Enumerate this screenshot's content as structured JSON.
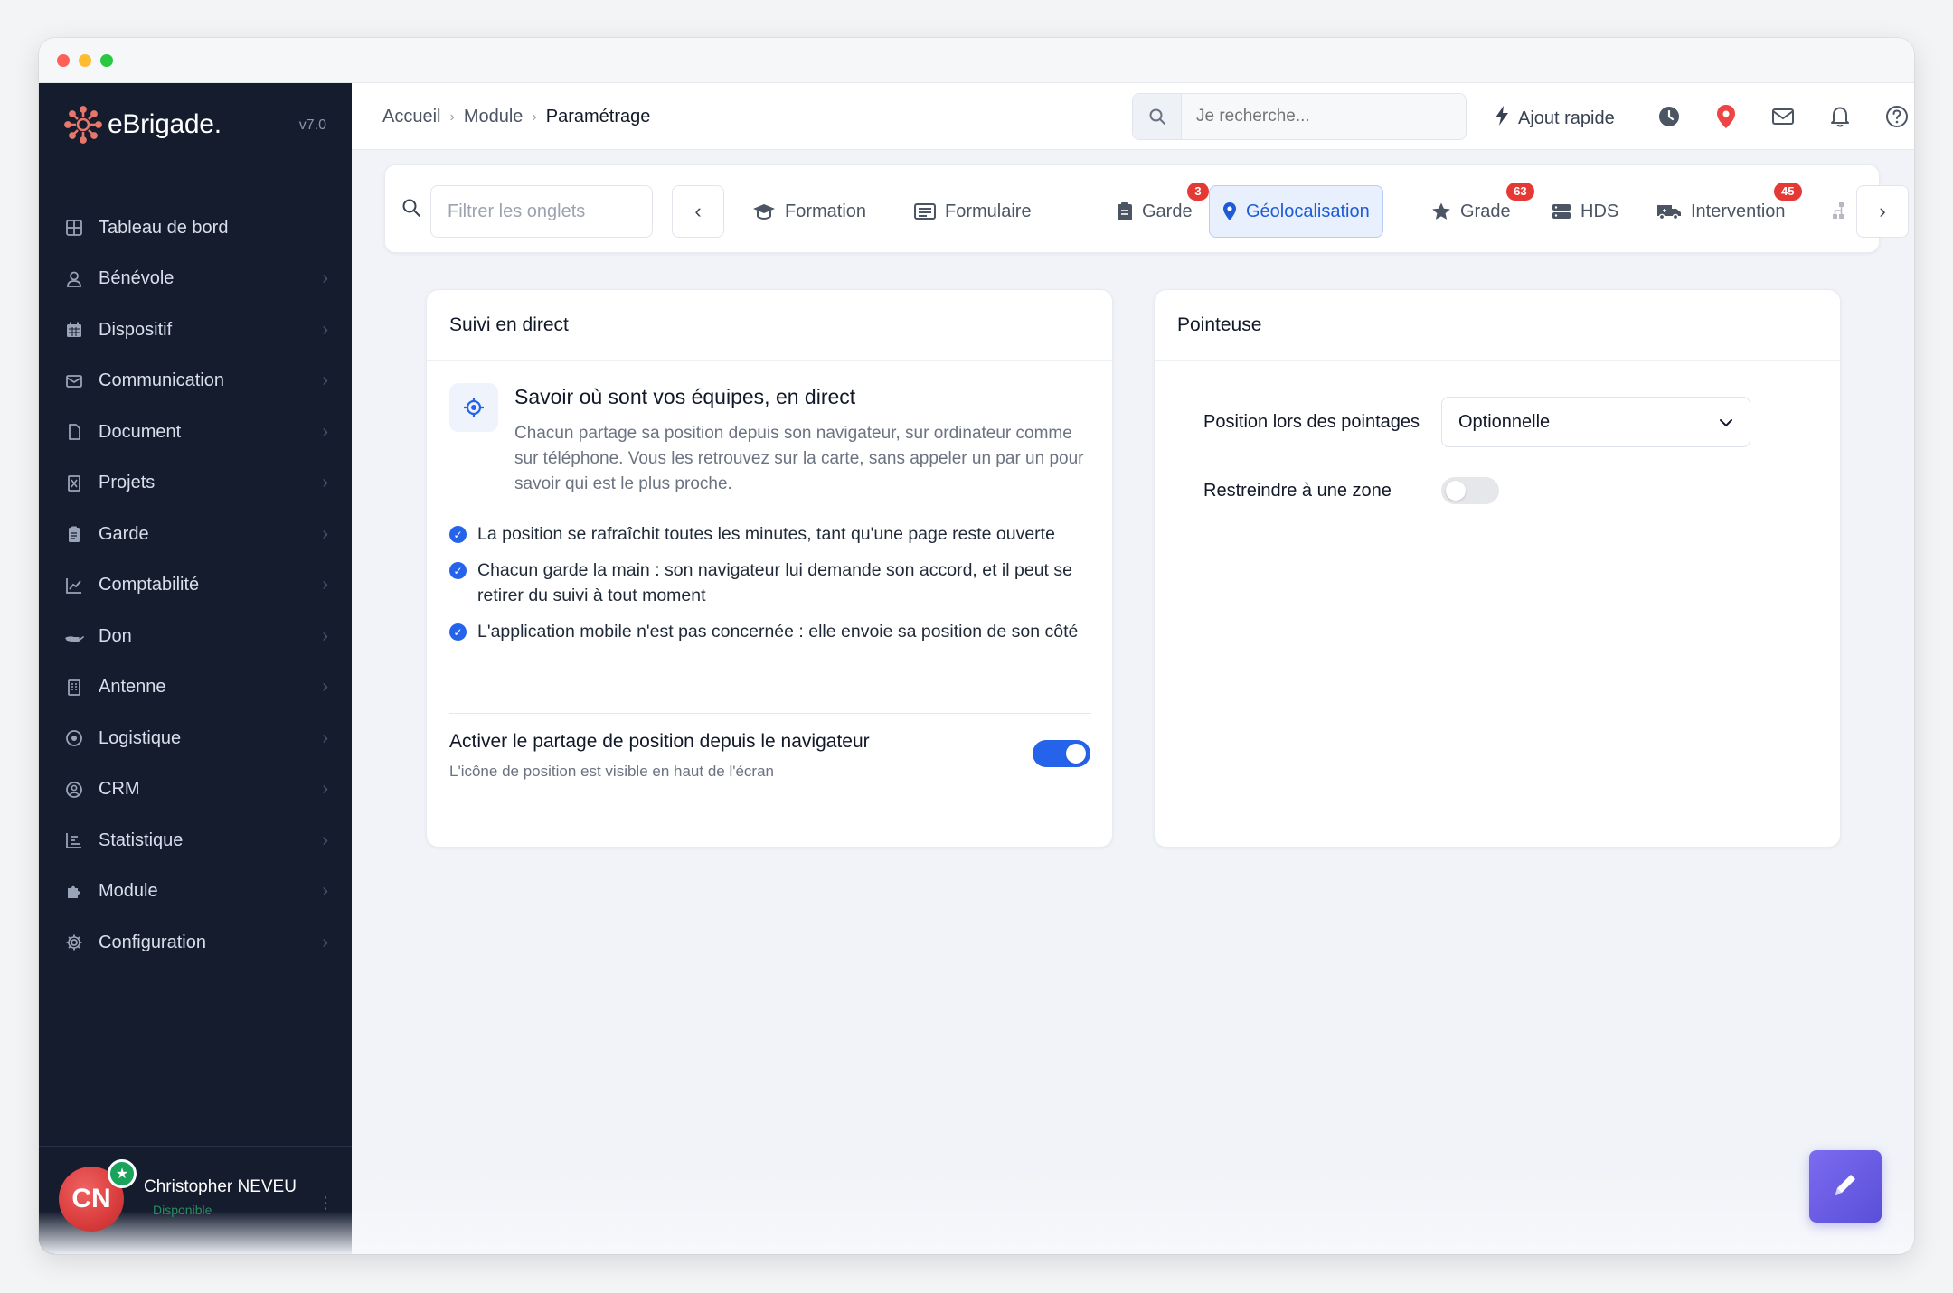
{
  "app": {
    "brand": "eBrigade.",
    "version": "v7.0"
  },
  "sidebar": {
    "items": [
      {
        "label": "Tableau de bord",
        "icon": "dashboard-icon",
        "chevron": false
      },
      {
        "label": "Bénévole",
        "icon": "user-icon",
        "chevron": true
      },
      {
        "label": "Dispositif",
        "icon": "calendar-icon",
        "chevron": true
      },
      {
        "label": "Communication",
        "icon": "mail-icon",
        "chevron": true
      },
      {
        "label": "Document",
        "icon": "file-icon",
        "chevron": true
      },
      {
        "label": "Projets",
        "icon": "project-icon",
        "chevron": true
      },
      {
        "label": "Garde",
        "icon": "clipboard-icon",
        "chevron": true
      },
      {
        "label": "Comptabilité",
        "icon": "chart-line-icon",
        "chevron": true
      },
      {
        "label": "Don",
        "icon": "hand-icon",
        "chevron": true
      },
      {
        "label": "Antenne",
        "icon": "building-icon",
        "chevron": true
      },
      {
        "label": "Logistique",
        "icon": "target-icon",
        "chevron": true
      },
      {
        "label": "CRM",
        "icon": "crm-icon",
        "chevron": true
      },
      {
        "label": "Statistique",
        "icon": "stats-icon",
        "chevron": true
      },
      {
        "label": "Module",
        "icon": "puzzle-icon",
        "chevron": true
      },
      {
        "label": "Configuration",
        "icon": "gear-icon",
        "chevron": true
      }
    ],
    "user": {
      "initials": "CN",
      "name": "Christopher NEVEU",
      "status": "Disponible"
    }
  },
  "topbar": {
    "breadcrumb": [
      "Accueil",
      "Module",
      "Paramétrage"
    ],
    "search_placeholder": "Je recherche...",
    "quick_add": "Ajout rapide"
  },
  "tabs": {
    "filter_placeholder": "Filtrer les onglets",
    "items": [
      {
        "label": "Formation",
        "badge": null,
        "active": false
      },
      {
        "label": "Formulaire",
        "badge": null,
        "active": false
      },
      {
        "label": "Garde",
        "badge": "3",
        "active": false
      },
      {
        "label": "Géolocalisation",
        "badge": null,
        "active": true
      },
      {
        "label": "Grade",
        "badge": "63",
        "active": false
      },
      {
        "label": "HDS",
        "badge": null,
        "active": false
      },
      {
        "label": "Intervention",
        "badge": "45",
        "active": false
      }
    ]
  },
  "live_tracking": {
    "title": "Suivi en direct",
    "feature_title": "Savoir où sont vos équipes, en direct",
    "feature_desc": "Chacun partage sa position depuis son navigateur, sur ordinateur comme sur téléphone. Vous les retrouvez sur la carte, sans appeler un par un pour savoir qui est le plus proche.",
    "checks": [
      "La position se rafraîchit toutes les minutes, tant qu'une page reste ouverte",
      "Chacun garde la main : son navigateur lui demande son accord, et il peut se retirer du suivi à tout moment",
      "L'application mobile n'est pas concernée : elle envoie sa position de son côté"
    ],
    "toggle_label": "Activer le partage de position depuis le navigateur",
    "toggle_hint": "L'icône de position est visible en haut de l'écran",
    "toggle_on": true
  },
  "clock": {
    "title": "Pointeuse",
    "position_label": "Position lors des pointages",
    "position_value": "Optionnelle",
    "zone_label": "Restreindre à une zone",
    "zone_on": false
  },
  "colors": {
    "accent": "#2563eb",
    "sidebar_bg": "#141c2e",
    "badge": "#e53935",
    "brand_mark": "#e8776b"
  }
}
